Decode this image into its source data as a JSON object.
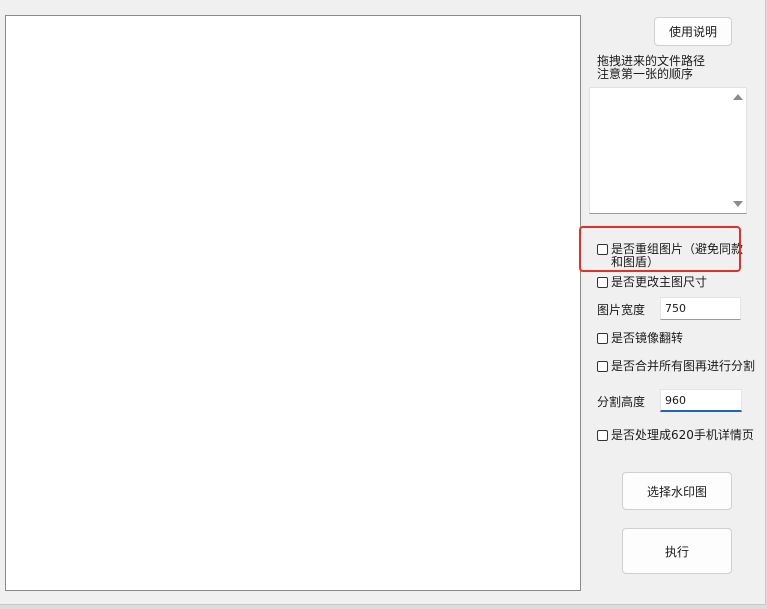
{
  "buttons": {
    "help_label": "使用说明",
    "watermark_label": "选择水印图",
    "run_label": "执行"
  },
  "hint": {
    "line1": "拖拽进来的文件路径",
    "line2": "注意第一张的顺序"
  },
  "path_list": {
    "value": ""
  },
  "options": {
    "regroup": {
      "label": "是否重组图片（避免同款和图盾）",
      "checked": false
    },
    "resize": {
      "label": "是否更改主图尺寸",
      "checked": false
    },
    "mirror": {
      "label": "是否镜像翻转",
      "checked": false
    },
    "merge_split": {
      "label": "是否合并所有图再进行分割",
      "checked": false
    },
    "mobile_detail": {
      "label": "是否处理成620手机详情页",
      "checked": false
    }
  },
  "fields": {
    "width_label": "图片宽度",
    "width_value": "750",
    "split_label": "分割高度",
    "split_value": "960"
  },
  "colors": {
    "highlight": "#e0302a",
    "focus_underline": "#1a66c2"
  }
}
